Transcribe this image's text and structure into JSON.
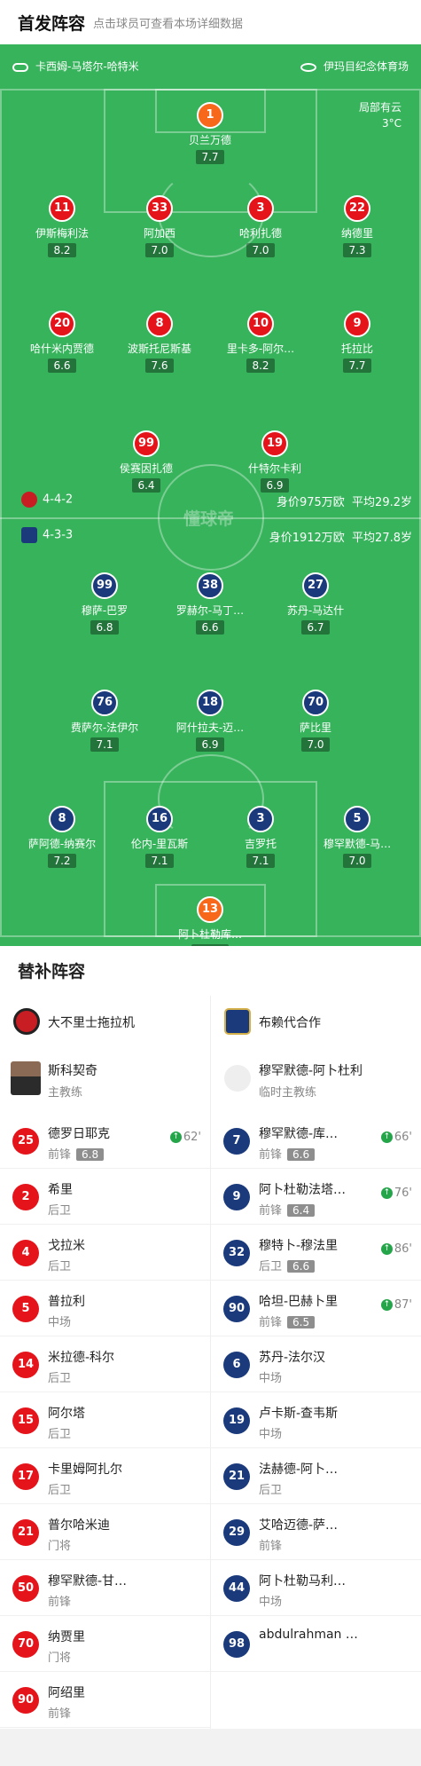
{
  "header": {
    "title": "首发阵容",
    "subtitle": "点击球员可查看本场详细数据"
  },
  "pitch": {
    "referee": "卡西姆-马塔尔-哈特米",
    "stadium": "伊玛目纪念体育场",
    "weather": "局部有云",
    "temperature": "3°C",
    "watermark": "懂球帝",
    "home": {
      "formation": "4-4-2",
      "value": "身价975万欧",
      "age": "平均29.2岁"
    },
    "away": {
      "formation": "4-3-3",
      "value": "身价1912万欧",
      "age": "平均27.8岁"
    },
    "home_players": [
      {
        "num": "1",
        "name": "贝兰万德",
        "rating": "7.7",
        "color": "org"
      },
      {
        "num": "11",
        "name": "伊斯梅利法",
        "rating": "8.2",
        "color": "red"
      },
      {
        "num": "33",
        "name": "阿加西",
        "rating": "7.0",
        "color": "red"
      },
      {
        "num": "3",
        "name": "哈利扎德",
        "rating": "7.0",
        "color": "red",
        "yellow": true,
        "captain": "C"
      },
      {
        "num": "22",
        "name": "纳德里",
        "rating": "7.3",
        "color": "red"
      },
      {
        "num": "20",
        "name": "哈什米内贾德",
        "rating": "6.6",
        "color": "red",
        "yellow": true
      },
      {
        "num": "8",
        "name": "波斯托尼斯基",
        "rating": "7.6",
        "color": "red"
      },
      {
        "num": "10",
        "name": "里卡多-阿尔…",
        "rating": "8.2",
        "color": "red"
      },
      {
        "num": "9",
        "name": "托拉比",
        "rating": "7.7",
        "color": "red"
      },
      {
        "num": "99",
        "name": "侯赛因扎德",
        "rating": "6.4",
        "color": "red"
      },
      {
        "num": "19",
        "name": "什特尔卡利",
        "rating": "6.9",
        "color": "red",
        "sub": "62'"
      }
    ],
    "away_players": [
      {
        "num": "99",
        "name": "穆萨-巴罗",
        "rating": "6.8",
        "color": "blue"
      },
      {
        "num": "38",
        "name": "罗赫尔-马丁…",
        "rating": "6.6",
        "color": "blue",
        "sub": "76'"
      },
      {
        "num": "27",
        "name": "苏丹-马达什",
        "rating": "6.7",
        "color": "blue",
        "sub": "66'"
      },
      {
        "num": "76",
        "name": "费萨尔-法伊尔",
        "rating": "7.1",
        "color": "blue"
      },
      {
        "num": "18",
        "name": "阿什拉夫-迈…",
        "rating": "6.9",
        "color": "blue",
        "captain": "C"
      },
      {
        "num": "70",
        "name": "萨比里",
        "rating": "7.0",
        "color": "blue",
        "sub": "87'"
      },
      {
        "num": "8",
        "name": "萨阿德-纳赛尔",
        "rating": "7.2",
        "color": "blue",
        "sub": "86'"
      },
      {
        "num": "16",
        "name": "伦内-里瓦斯",
        "rating": "7.1",
        "color": "blue"
      },
      {
        "num": "3",
        "name": "吉罗托",
        "rating": "7.1",
        "color": "blue"
      },
      {
        "num": "5",
        "name": "穆罕默德-马…",
        "rating": "7.0",
        "color": "blue"
      },
      {
        "num": "13",
        "name": "阿卜杜勒库…",
        "rating": "8.5",
        "color": "org",
        "star": "★"
      }
    ]
  },
  "subs": {
    "title": "替补阵容",
    "home": {
      "team": "大不里士拖拉机",
      "coach": "斯科契奇",
      "coach_role": "主教练",
      "players": [
        {
          "num": "25",
          "name": "德罗日耶克",
          "pos": "前锋",
          "rating": "6.8",
          "in": "62'"
        },
        {
          "num": "2",
          "name": "希里",
          "pos": "后卫"
        },
        {
          "num": "4",
          "name": "戈拉米",
          "pos": "后卫"
        },
        {
          "num": "5",
          "name": "普拉利",
          "pos": "中场"
        },
        {
          "num": "14",
          "name": "米拉德-科尔",
          "pos": "后卫"
        },
        {
          "num": "15",
          "name": "阿尔塔",
          "pos": "后卫"
        },
        {
          "num": "17",
          "name": "卡里姆阿扎尔",
          "pos": "后卫"
        },
        {
          "num": "21",
          "name": "普尔哈米迪",
          "pos": "门将"
        },
        {
          "num": "50",
          "name": "穆罕默德-甘…",
          "pos": "前锋"
        },
        {
          "num": "70",
          "name": "纳贾里",
          "pos": "门将"
        },
        {
          "num": "90",
          "name": "阿绍里",
          "pos": "前锋"
        }
      ]
    },
    "away": {
      "team": "布赖代合作",
      "coach": "穆罕默德-阿卜杜利",
      "coach_role": "临时主教练",
      "players": [
        {
          "num": "7",
          "name": "穆罕默德-库…",
          "pos": "前锋",
          "rating": "6.6",
          "in": "66'"
        },
        {
          "num": "9",
          "name": "阿卜杜勒法塔…",
          "pos": "前锋",
          "rating": "6.4",
          "in": "76'"
        },
        {
          "num": "32",
          "name": "穆特卜-穆法里",
          "pos": "后卫",
          "rating": "6.6",
          "in": "86'"
        },
        {
          "num": "90",
          "name": "哈坦-巴赫卜里",
          "pos": "前锋",
          "rating": "6.5",
          "in": "87'"
        },
        {
          "num": "6",
          "name": "苏丹-法尔汉",
          "pos": "中场"
        },
        {
          "num": "19",
          "name": "卢卡斯-查韦斯",
          "pos": "中场"
        },
        {
          "num": "21",
          "name": "法赫德-阿卜…",
          "pos": "后卫"
        },
        {
          "num": "29",
          "name": "艾哈迈德-萨…",
          "pos": "前锋"
        },
        {
          "num": "44",
          "name": "阿卜杜勒马利…",
          "pos": "中场"
        },
        {
          "num": "98",
          "name": "abdulrahman …",
          "pos": ""
        }
      ]
    }
  }
}
